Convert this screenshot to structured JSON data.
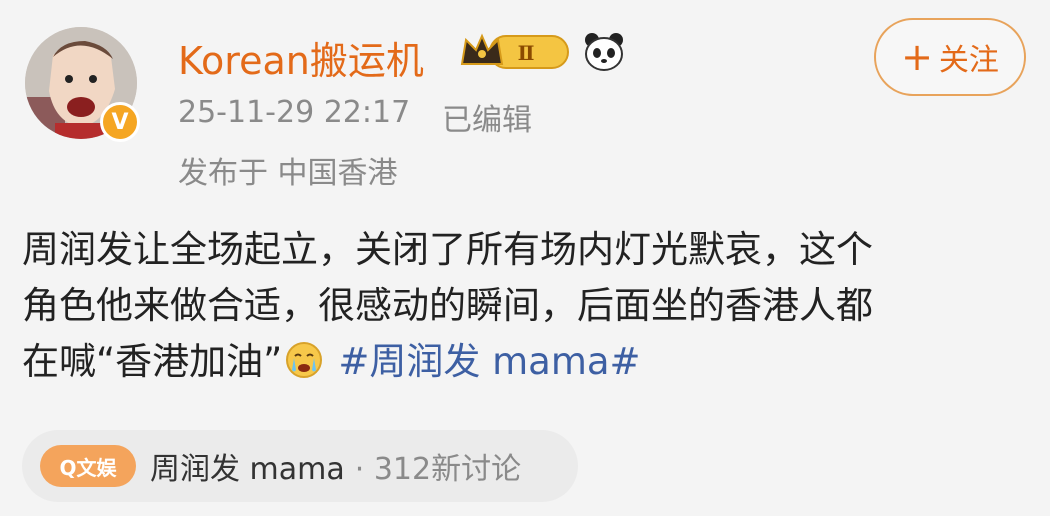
{
  "header": {
    "username": "Korean搬运机",
    "level_badge": "Ⅱ",
    "verified_mark": "V",
    "timestamp": "25-11-29 22:17",
    "edited": "已编辑",
    "location": "发布于 中国香港"
  },
  "follow": {
    "plus": "+",
    "label": "关注"
  },
  "post": {
    "line1": "周润发让全场起立，关闭了所有场内灯光默哀，这个",
    "line2": "角色他来做合适，很感动的瞬间，后面坐的香港人都",
    "line3": "在喊“香港加油”",
    "hashtag": "#周润发 mama#"
  },
  "topic": {
    "badge": "Q文娱",
    "name": "周润发 mama",
    "count": "· 312新讨论"
  },
  "colors": {
    "username": "#e36a19",
    "hashtag": "#3d5fa3",
    "follow_border": "#e8a35b",
    "background": "#f4f4f4"
  },
  "icons": [
    "crown-icon",
    "panda-icon",
    "crying-emoji-icon",
    "search-icon",
    "verified-icon"
  ]
}
